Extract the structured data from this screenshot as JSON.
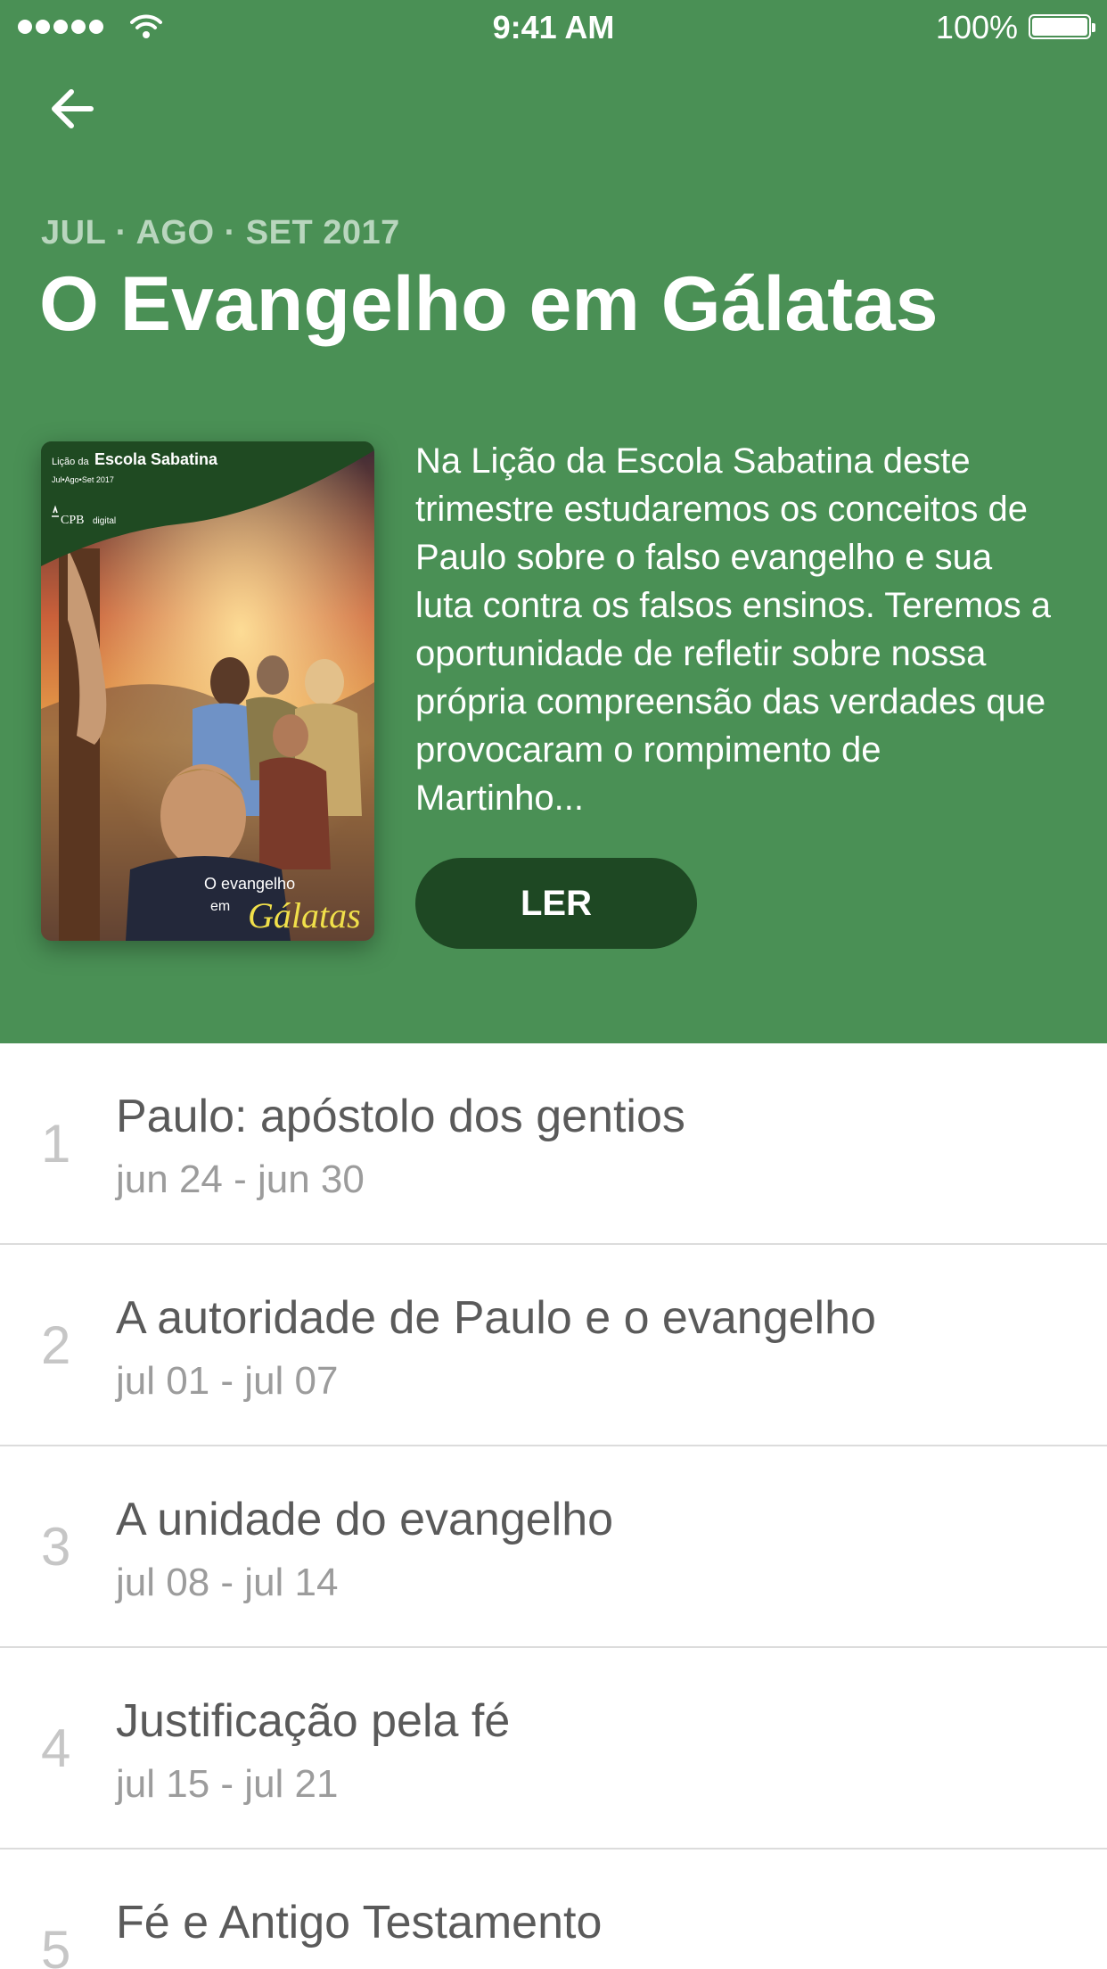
{
  "status_bar": {
    "time": "9:41 AM",
    "battery": "100%"
  },
  "header": {
    "quarter": "JUL · AGO · SET 2017",
    "title": "O Evangelho em Gálatas",
    "description": "Na Lição da Escola Sabatina deste trimestre estudaremos os conceitos de Paulo sobre o falso evangelho e sua luta contra os falsos ensinos. Teremos a oportunidade de refletir sobre nossa própria compreensão das verdades que provocaram o rompimento de Martinho...",
    "read_label": "LER",
    "accent_color": "#4a9055"
  },
  "cover": {
    "top_small": "Lição da",
    "top_title": "Escola Sabatina",
    "top_sub": "Jul•Ago•Set 2017",
    "publisher": "CPB",
    "publisher_sub": "digital",
    "bottom_line1": "O evangelho",
    "bottom_line2": "em",
    "bottom_word": "Gálatas"
  },
  "lessons": [
    {
      "number": "1",
      "title": "Paulo: apóstolo dos gentios",
      "dates": "jun 24 - jun 30"
    },
    {
      "number": "2",
      "title": "A autoridade de Paulo e o evangelho",
      "dates": "jul 01 - jul 07"
    },
    {
      "number": "3",
      "title": "A unidade do evangelho",
      "dates": "jul 08 - jul 14"
    },
    {
      "number": "4",
      "title": "Justificação pela fé",
      "dates": "jul 15 - jul 21"
    },
    {
      "number": "5",
      "title": "Fé e Antigo Testamento",
      "dates": ""
    }
  ]
}
